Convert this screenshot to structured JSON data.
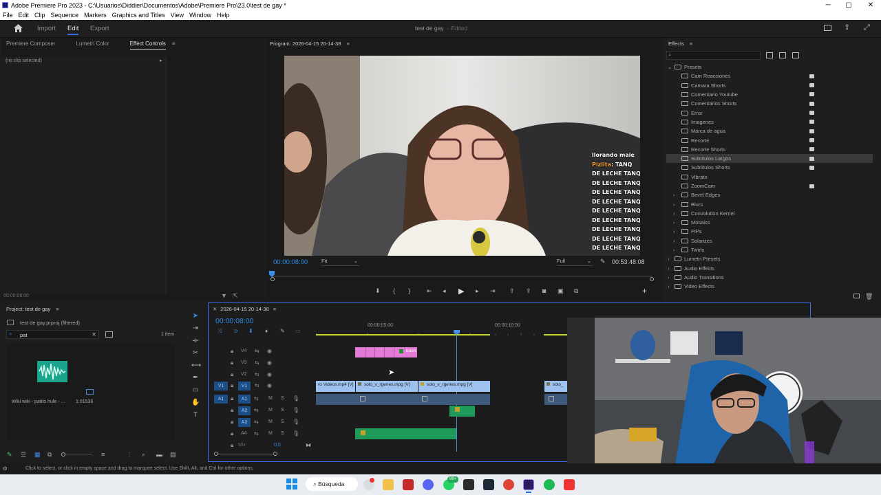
{
  "window": {
    "title": "Adobe Premiere Pro 2023 - C:\\Usuarios\\Diddier\\Documentos\\Adobe\\Premiere Pro\\23.0\\test de gay *",
    "controls": [
      "─",
      "▢",
      "✕"
    ]
  },
  "menu": [
    "File",
    "Edit",
    "Clip",
    "Sequence",
    "Markers",
    "Graphics and Titles",
    "View",
    "Window",
    "Help"
  ],
  "header": {
    "tabs": [
      "Import",
      "Edit",
      "Export"
    ],
    "active_tab": "Edit",
    "project_title": "test de gay",
    "status": "- Edited"
  },
  "left_panel": {
    "tabs": [
      "Premiere Composer",
      "Lumetri Color",
      "Effect Controls"
    ],
    "active_tab": "Effect Controls",
    "no_clip": "(no clip selected)",
    "timecode": "00:00:08:00"
  },
  "program_monitor": {
    "title": "Program: 2026-04-15 20-14-38",
    "timecode": "00:00:08:00",
    "fit": "Fit",
    "quality": "Full",
    "duration": "00:53:48:08",
    "chat": {
      "line1": "llorando maie",
      "user": "Pizlita",
      "line2": ": TANQ",
      "repeated": "DE LECHE TANQ"
    }
  },
  "effects": {
    "title": "Effects",
    "search_placeholder": "",
    "presets_label": "Presets",
    "presets": [
      "Cam Reacciones",
      "Camara Shorts",
      "Comentario Youtube",
      "Comentarios Shorts",
      "Error",
      "Imagenes",
      "Marca de agua",
      "Recorte",
      "Recorte Shorts",
      "Subtitulos Largos",
      "Subtitulos Shorts",
      "Vibrato",
      "ZoomCam"
    ],
    "selected_preset": "Subtitulos Largos",
    "groups": [
      "Bevel Edges",
      "Blurs",
      "Convolution Kernel",
      "Mosaics",
      "PiPs",
      "Solarizes",
      "Twirls"
    ],
    "top_folders": [
      "Lumetri Presets",
      "Audio Effects",
      "Audio Transitions",
      "Video Effects"
    ]
  },
  "project": {
    "title": "Project: test de gay",
    "file": "test de gay.prproj (filtered)",
    "search_value": "pat",
    "count": "1 item",
    "item_name": "Wiki wiki - patito hule - ...",
    "item_duration": "1:01536"
  },
  "timeline": {
    "title": "2026-04-15 20-14-38",
    "timecode": "00:00:08:00",
    "ruler": [
      "00:00:05:00",
      "00:00:10:00"
    ],
    "video_tracks": [
      "V4",
      "V3",
      "V2",
      "V1"
    ],
    "audio_tracks": [
      "A1",
      "A2",
      "A3",
      "A4"
    ],
    "mix_label": "Mix",
    "mix_value": "0,0",
    "clips": {
      "v4_label": "buen",
      "v1_a": "ro Videos.mp4 [V]",
      "v1_b": "solo_v_rgenes.mpg [V]",
      "v1_c": "solo_v_rgenes.mpg [V]",
      "v1_d": "solo_"
    },
    "track_btns": {
      "mute": "M",
      "solo": "S"
    }
  },
  "status_bar": "Click to select, or click in empty space and drag to marquee select. Use Shift, Alt, and Ctrl for other options.",
  "taskbar": {
    "search_label": "Búsqueda",
    "badge": "99+"
  },
  "colors": {
    "accent": "#3a6cf0",
    "timecode_blue": "#2d8ceb",
    "clip_pink": "#e37bd6",
    "clip_blue": "#9dc2f0",
    "clip_green": "#1f9a5b",
    "playhead": "#4a90e2"
  }
}
